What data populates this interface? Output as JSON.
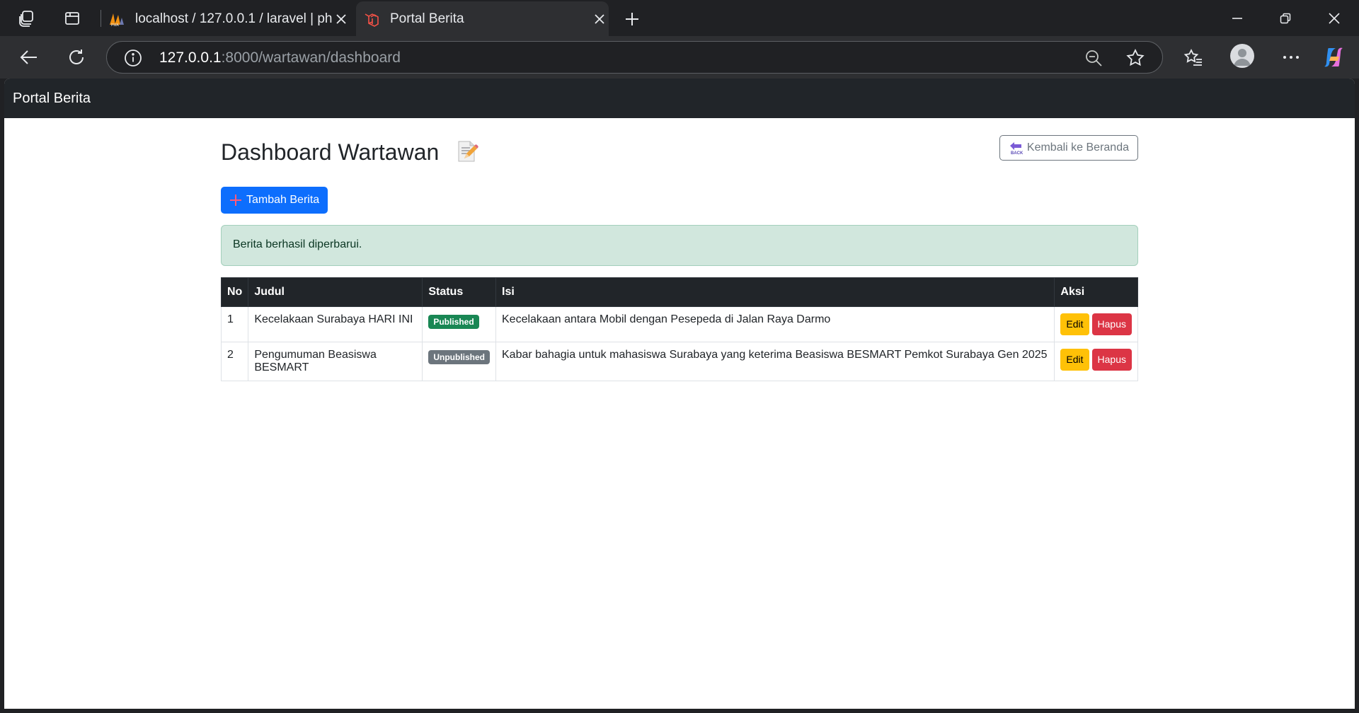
{
  "browser": {
    "tabs": [
      {
        "title": "localhost / 127.0.0.1 / laravel | phpMyAdmin",
        "active": false,
        "favicon": "phpmyadmin-icon"
      },
      {
        "title": "Portal Berita",
        "active": true,
        "favicon": "laravel-icon"
      }
    ],
    "url": {
      "host": "127.0.0.1",
      "path": ":8000/wartawan/dashboard"
    }
  },
  "app": {
    "brand": "Portal Berita",
    "page_title": "Dashboard Wartawan",
    "back_label": "Kembali ke Beranda",
    "add_label": "Tambah Berita",
    "alert": "Berita berhasil diperbarui.",
    "table": {
      "headers": {
        "no": "No",
        "judul": "Judul",
        "status": "Status",
        "isi": "Isi",
        "aksi": "Aksi"
      },
      "rows": [
        {
          "no": "1",
          "judul": "Kecelakaan Surabaya HARI INI",
          "status": "Published",
          "isi": "Kecelakaan antara Mobil dengan Pesepeda di Jalan Raya Darmo",
          "edit": "Edit",
          "hapus": "Hapus"
        },
        {
          "no": "2",
          "judul": "Pengumuman Beasiswa BESMART",
          "status": "Unpublished",
          "isi": "Kabar bahagia untuk mahasiswa Surabaya yang keterima Beasiswa BESMART Pemkot Surabaya Gen 2025",
          "edit": "Edit",
          "hapus": "Hapus"
        }
      ]
    }
  },
  "colors": {
    "primary": "#0d6efd",
    "success": "#198754",
    "secondary": "#6c757d",
    "warning": "#ffc107",
    "danger": "#dc3545",
    "navbar": "#212529",
    "alert_bg": "#d1e7dd"
  }
}
